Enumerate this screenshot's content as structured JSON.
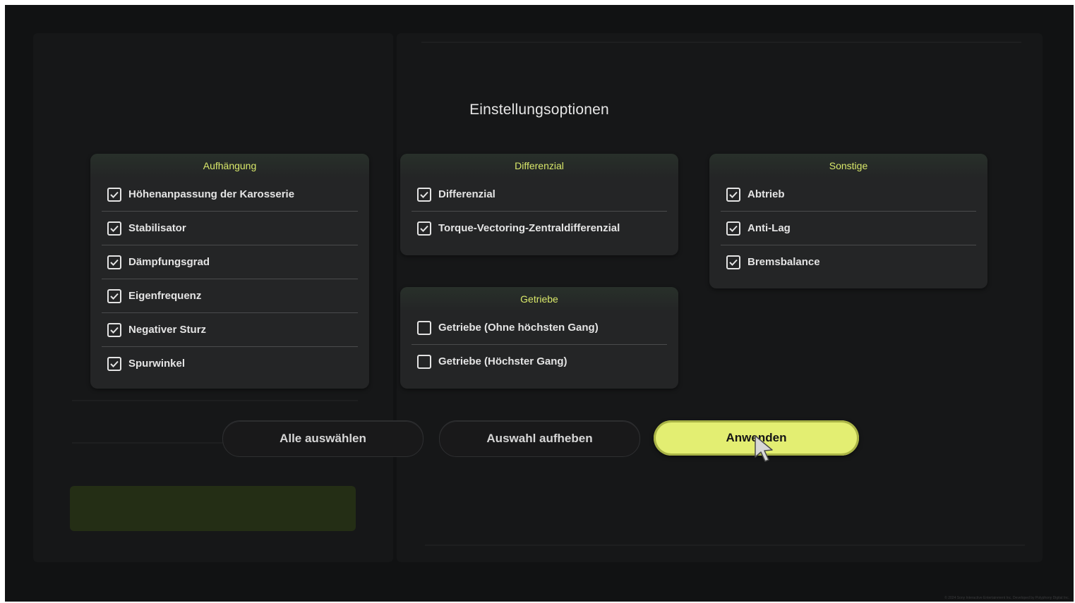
{
  "dialog": {
    "title": "Einstellungsoptionen"
  },
  "panels": {
    "aufhaengung": {
      "title": "Aufhängung",
      "options": [
        {
          "label": "Höhenanpassung der Karosserie",
          "checked": true
        },
        {
          "label": "Stabilisator",
          "checked": true
        },
        {
          "label": "Dämpfungsgrad",
          "checked": true
        },
        {
          "label": "Eigenfrequenz",
          "checked": true
        },
        {
          "label": "Negativer Sturz",
          "checked": true
        },
        {
          "label": "Spurwinkel",
          "checked": true
        }
      ]
    },
    "differenzial": {
      "title": "Differenzial",
      "options": [
        {
          "label": "Differenzial",
          "checked": true
        },
        {
          "label": "Torque-Vectoring-Zentraldifferenzial",
          "checked": true
        }
      ]
    },
    "getriebe": {
      "title": "Getriebe",
      "options": [
        {
          "label": "Getriebe (Ohne höchsten Gang)",
          "checked": false
        },
        {
          "label": "Getriebe (Höchster Gang)",
          "checked": false
        }
      ]
    },
    "sonstige": {
      "title": "Sonstige",
      "options": [
        {
          "label": "Abtrieb",
          "checked": true
        },
        {
          "label": "Anti-Lag",
          "checked": true
        },
        {
          "label": "Bremsbalance",
          "checked": true
        }
      ]
    }
  },
  "buttons": {
    "select_all": "Alle auswählen",
    "deselect": "Auswahl aufheben",
    "apply": "Anwenden"
  },
  "colors": {
    "accent": "#e3ee72",
    "panel_header_text": "#d9e86a",
    "panel_bg": "#242526",
    "screen_bg": "#111213"
  },
  "footer": {
    "copyright": "© 2024 Sony Interactive Entertainment Inc. Developed by Polyphony Digital Inc."
  }
}
